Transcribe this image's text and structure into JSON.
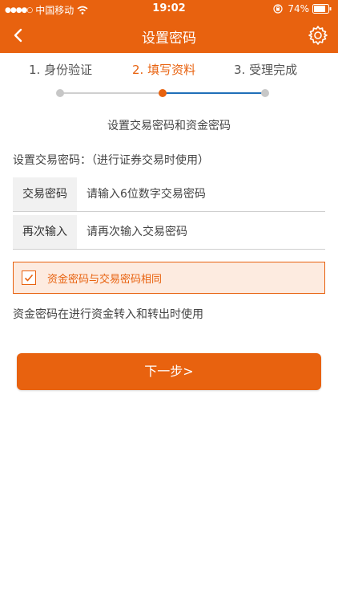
{
  "status_bar": {
    "signal": "●●●●○",
    "carrier": "中国移动",
    "time": "19:02",
    "battery": "74%"
  },
  "nav": {
    "title": "设置密码",
    "back_icon": "chevron-left-icon",
    "settings_icon": "gear-icon"
  },
  "steps": [
    {
      "label": "1. 身份验证"
    },
    {
      "label": "2. 填写资料"
    },
    {
      "label": "3. 受理完成"
    }
  ],
  "subtitle": "设置交易密码和资金密码",
  "section_label": "设置交易密码：（进行证券交易时使用）",
  "fields": {
    "trade_password": {
      "label": "交易密码",
      "placeholder": "请输入6位数字交易密码"
    },
    "confirm_password": {
      "label": "再次输入",
      "placeholder": "请再次输入交易密码"
    }
  },
  "same_password_checkbox": {
    "label": "资金密码与交易密码相同",
    "checked": true
  },
  "note": "资金密码在进行资金转入和转出时使用",
  "next_button": "下一步>",
  "colors": {
    "accent": "#e8620f",
    "progress_blue": "#1f6fb8",
    "checkbox_bg": "#fdebe0"
  }
}
